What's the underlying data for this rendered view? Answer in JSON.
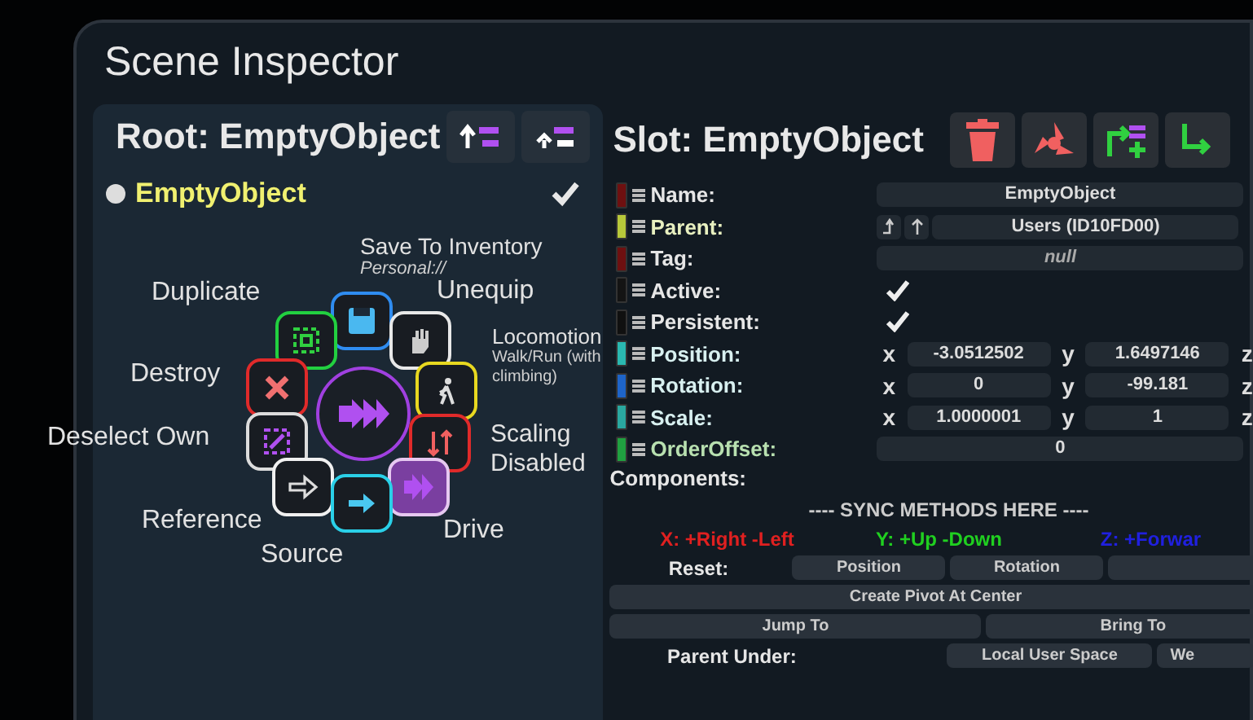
{
  "window": {
    "title": "Scene Inspector"
  },
  "hierarchy": {
    "title": "Root: EmptyObject",
    "root": {
      "label": "EmptyObject",
      "checked": true
    }
  },
  "radial_menu": {
    "items": [
      {
        "kind": "save",
        "label": "Save To Inventory",
        "sublabel": "Personal://",
        "color": "#2f8cf0",
        "active": false
      },
      {
        "kind": "duplicate",
        "label": "Duplicate",
        "color": "#22d040",
        "active": false
      },
      {
        "kind": "unequip",
        "label": "Unequip",
        "color": "#e8e8e8",
        "active": false
      },
      {
        "kind": "destroy",
        "label": "Destroy",
        "color": "#e02a2a",
        "active": false
      },
      {
        "kind": "locomotion",
        "label": "Locomotion",
        "sublabel": "Walk/Run (with climbing)",
        "color": "#e8d820",
        "active": false
      },
      {
        "kind": "deselect",
        "label": "Deselect Own",
        "color": "#dcdcdc",
        "active": false
      },
      {
        "kind": "scaling",
        "label": "Scaling Disabled",
        "color": "#e02a2a",
        "active": false
      },
      {
        "kind": "reference",
        "label": "Reference",
        "color": "#f0f0f0",
        "active": false
      },
      {
        "kind": "drive",
        "label": "Drive",
        "color": "#e6c8f0",
        "active": true
      },
      {
        "kind": "source",
        "label": "Source",
        "color": "#2ad0e8",
        "active": false
      }
    ]
  },
  "slot": {
    "title": "Slot: EmptyObject",
    "fields": [
      {
        "kind": "text",
        "label": "Name:",
        "color": "#6e1010",
        "value": "EmptyObject"
      },
      {
        "kind": "reference",
        "label": "Parent:",
        "color": "#b8c83a",
        "value": "Users (ID10FD00)"
      },
      {
        "kind": "text",
        "label": "Tag:",
        "color": "#6e1010",
        "value": "null",
        "is_null": true
      },
      {
        "kind": "checkbox",
        "label": "Active:",
        "color": "#141414",
        "checked": true
      },
      {
        "kind": "checkbox",
        "label": "Persistent:",
        "color": "#101010",
        "checked": true
      },
      {
        "kind": "vector",
        "label": "Position:",
        "color": "#2ab8b0",
        "components": [
          {
            "axis": "x",
            "value": "-3.0512502"
          },
          {
            "axis": "y",
            "value": "1.6497146"
          },
          {
            "axis": "z"
          }
        ]
      },
      {
        "kind": "vector",
        "label": "Rotation:",
        "color": "#1e64c8",
        "components": [
          {
            "axis": "x",
            "value": "0"
          },
          {
            "axis": "y",
            "value": "-99.181"
          },
          {
            "axis": "z"
          }
        ]
      },
      {
        "kind": "vector",
        "label": "Scale:",
        "color": "#2aa8a0",
        "components": [
          {
            "axis": "x",
            "value": "1.0000001"
          },
          {
            "axis": "y",
            "value": "1"
          },
          {
            "axis": "z"
          }
        ]
      },
      {
        "kind": "number",
        "label": "OrderOffset:",
        "color": "#20a040",
        "value": "0"
      }
    ],
    "components_label": "Components:",
    "sync_label": "---- SYNC METHODS HERE ----",
    "axis_hints": [
      {
        "text": "X: +Right -Left",
        "color": "#e02020"
      },
      {
        "text": "Y: +Up -Down",
        "color": "#20d020"
      },
      {
        "text": "Z: +Forwar",
        "color": "#2020e0"
      }
    ],
    "reset": {
      "label": "Reset:",
      "buttons": [
        "Position",
        "Rotation"
      ]
    },
    "create_pivot": "Create Pivot At Center",
    "move_buttons": [
      "Jump To",
      "Bring To"
    ],
    "parent_under": {
      "label": "Parent Under:",
      "buttons": [
        "Local User Space",
        "We"
      ]
    }
  }
}
